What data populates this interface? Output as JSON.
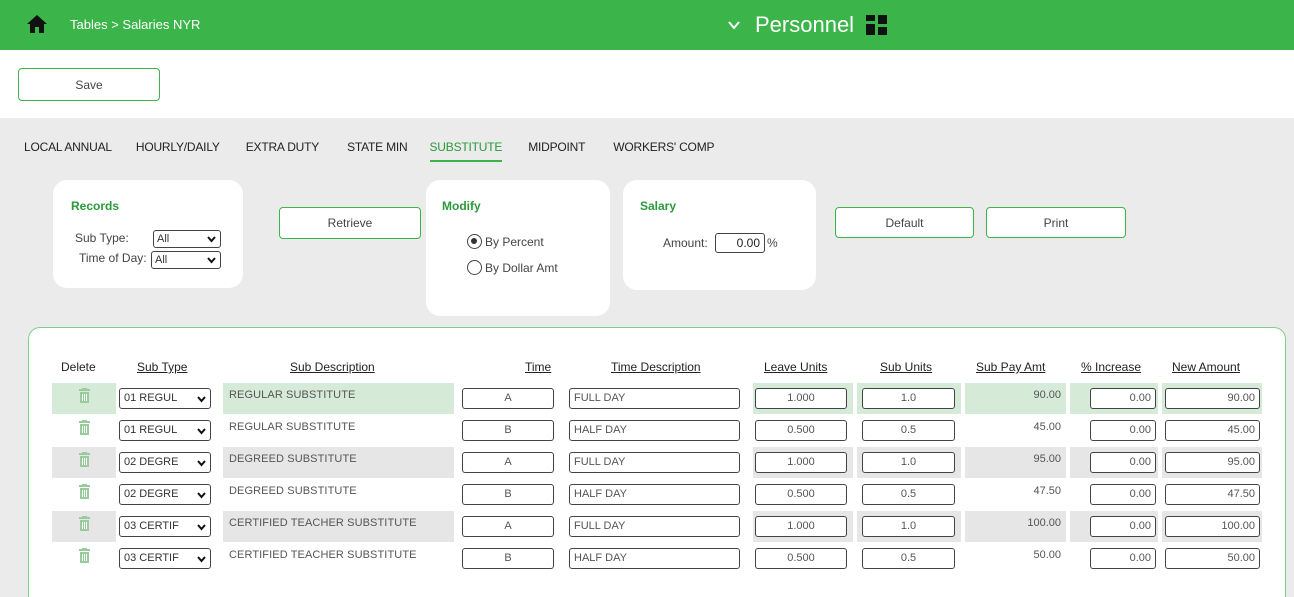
{
  "header": {
    "breadcrumb": "Tables > Salaries NYR",
    "module": "Personnel",
    "color": "#3bb54a"
  },
  "toolbar": {
    "save_label": "Save"
  },
  "tabs": [
    {
      "label": "LOCAL ANNUAL",
      "active": false
    },
    {
      "label": "HOURLY/DAILY",
      "active": false
    },
    {
      "label": "EXTRA DUTY",
      "active": false
    },
    {
      "label": "STATE MIN",
      "active": false
    },
    {
      "label": "SUBSTITUTE",
      "active": true
    },
    {
      "label": "MIDPOINT",
      "active": false
    },
    {
      "label": "WORKERS' COMP",
      "active": false
    }
  ],
  "records": {
    "title": "Records",
    "sub_type_label": "Sub Type:",
    "sub_type_value": "All",
    "time_of_day_label": "Time of Day:",
    "time_of_day_value": "All"
  },
  "retrieve_label": "Retrieve",
  "modify": {
    "title": "Modify",
    "by_percent": "By Percent",
    "by_dollar": "By Dollar Amt",
    "selected": "By Percent"
  },
  "salary": {
    "title": "Salary",
    "amount_label": "Amount:",
    "amount_value": "0.00",
    "unit": "%"
  },
  "default_label": "Default",
  "print_label": "Print",
  "columns": {
    "delete": "Delete",
    "sub_type": "Sub Type",
    "sub_description": "Sub Description",
    "time": "Time",
    "time_description": "Time Description",
    "leave_units": "Leave Units",
    "sub_units": "Sub Units",
    "sub_pay_amt": "Sub Pay Amt",
    "pct_increase": "% Increase",
    "new_amount": "New Amount"
  },
  "rows": [
    {
      "sub_type": "01 REGUL",
      "desc": "REGULAR SUBSTITUTE",
      "time": "A",
      "time_desc": "FULL DAY",
      "leave_units": "1.000",
      "sub_units": "1.0",
      "pay": "90.00",
      "increase": "0.00",
      "new_amount": "90.00"
    },
    {
      "sub_type": "01 REGUL",
      "desc": "REGULAR SUBSTITUTE",
      "time": "B",
      "time_desc": "HALF DAY",
      "leave_units": "0.500",
      "sub_units": "0.5",
      "pay": "45.00",
      "increase": "0.00",
      "new_amount": "45.00"
    },
    {
      "sub_type": "02 DEGRE",
      "desc": "DEGREED SUBSTITUTE",
      "time": "A",
      "time_desc": "FULL DAY",
      "leave_units": "1.000",
      "sub_units": "1.0",
      "pay": "95.00",
      "increase": "0.00",
      "new_amount": "95.00"
    },
    {
      "sub_type": "02 DEGRE",
      "desc": "DEGREED SUBSTITUTE",
      "time": "B",
      "time_desc": "HALF DAY",
      "leave_units": "0.500",
      "sub_units": "0.5",
      "pay": "47.50",
      "increase": "0.00",
      "new_amount": "47.50"
    },
    {
      "sub_type": "03 CERTIF",
      "desc": "CERTIFIED TEACHER SUBSTITUTE",
      "time": "A",
      "time_desc": "FULL DAY",
      "leave_units": "1.000",
      "sub_units": "1.0",
      "pay": "100.00",
      "increase": "0.00",
      "new_amount": "100.00"
    },
    {
      "sub_type": "03 CERTIF",
      "desc": "CERTIFIED TEACHER SUBSTITUTE",
      "time": "B",
      "time_desc": "HALF DAY",
      "leave_units": "0.500",
      "sub_units": "0.5",
      "pay": "50.00",
      "increase": "0.00",
      "new_amount": "50.00"
    }
  ]
}
